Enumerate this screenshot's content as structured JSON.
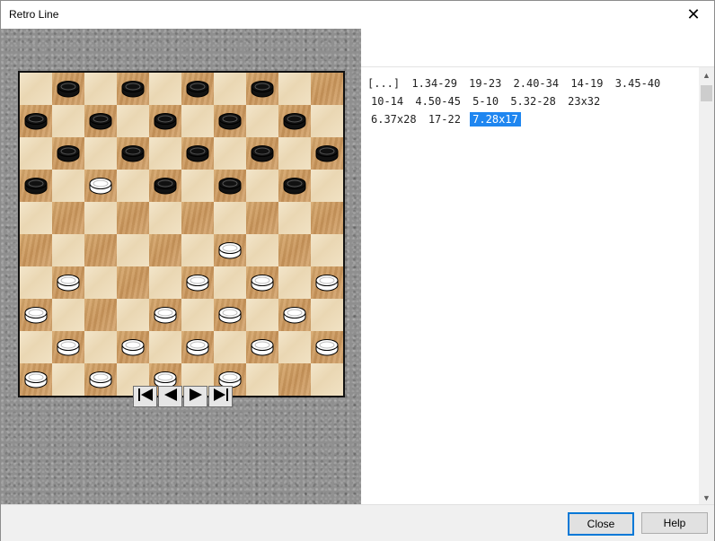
{
  "window": {
    "title": "Retro Line",
    "close_glyph": "✕"
  },
  "board": {
    "size": 10,
    "colors": {
      "light_square": "#f1e2c4",
      "dark_square": "#d0a065",
      "black_piece": "#111111",
      "white_piece": "#ffffff"
    },
    "rows": [
      "-b-b-b-b--",
      "b-b-b-b-b-",
      "-b-b-b-b-b",
      "b-w-b-b-b-",
      "----------",
      "------w---",
      "-w---w-w-w",
      "w---w-w-w-",
      "-w-w-w-w-w",
      "w-w-w-w---"
    ]
  },
  "navigation": {
    "buttons": [
      {
        "name": "first-move-button",
        "icon": "first-icon"
      },
      {
        "name": "previous-move-button",
        "icon": "prev-icon"
      },
      {
        "name": "next-move-button",
        "icon": "next-icon"
      },
      {
        "name": "last-move-button",
        "icon": "last-icon"
      }
    ]
  },
  "moves": {
    "lines": [
      [
        "[...]",
        "1.34-29",
        "19-23",
        "2.40-34",
        "14-19",
        "3.45-40"
      ],
      [
        "10-14",
        "4.50-45",
        "5-10",
        "5.32-28",
        "23x32"
      ],
      [
        "6.37x28",
        "17-22",
        "7.28x17"
      ]
    ],
    "selected": "7.28x17"
  },
  "footer": {
    "close_label": "Close",
    "help_label": "Help"
  }
}
